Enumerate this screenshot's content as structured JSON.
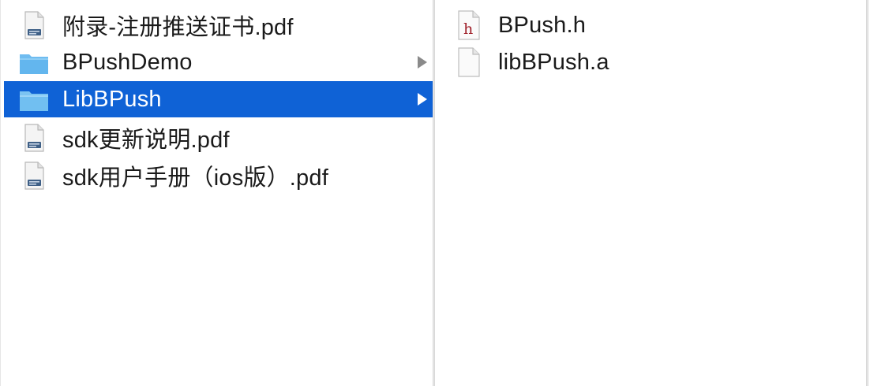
{
  "left_column": {
    "items": [
      {
        "label": "附录-注册推送证书.pdf",
        "icon": "pdf-document-icon",
        "has_chevron": false,
        "selected": false
      },
      {
        "label": "BPushDemo",
        "icon": "folder-icon",
        "has_chevron": true,
        "selected": false
      },
      {
        "label": "LibBPush",
        "icon": "folder-icon",
        "has_chevron": true,
        "selected": true
      },
      {
        "label": "sdk更新说明.pdf",
        "icon": "pdf-document-icon",
        "has_chevron": false,
        "selected": false
      },
      {
        "label": "sdk用户手册（ios版）.pdf",
        "icon": "pdf-document-icon",
        "has_chevron": false,
        "selected": false
      }
    ]
  },
  "right_column": {
    "items": [
      {
        "label": "BPush.h",
        "icon": "header-file-icon"
      },
      {
        "label": "libBPush.a",
        "icon": "blank-document-icon"
      }
    ]
  },
  "colors": {
    "selection": "#0f62d6",
    "folder": "#63b6ee",
    "header_letter": "#a0202a"
  }
}
